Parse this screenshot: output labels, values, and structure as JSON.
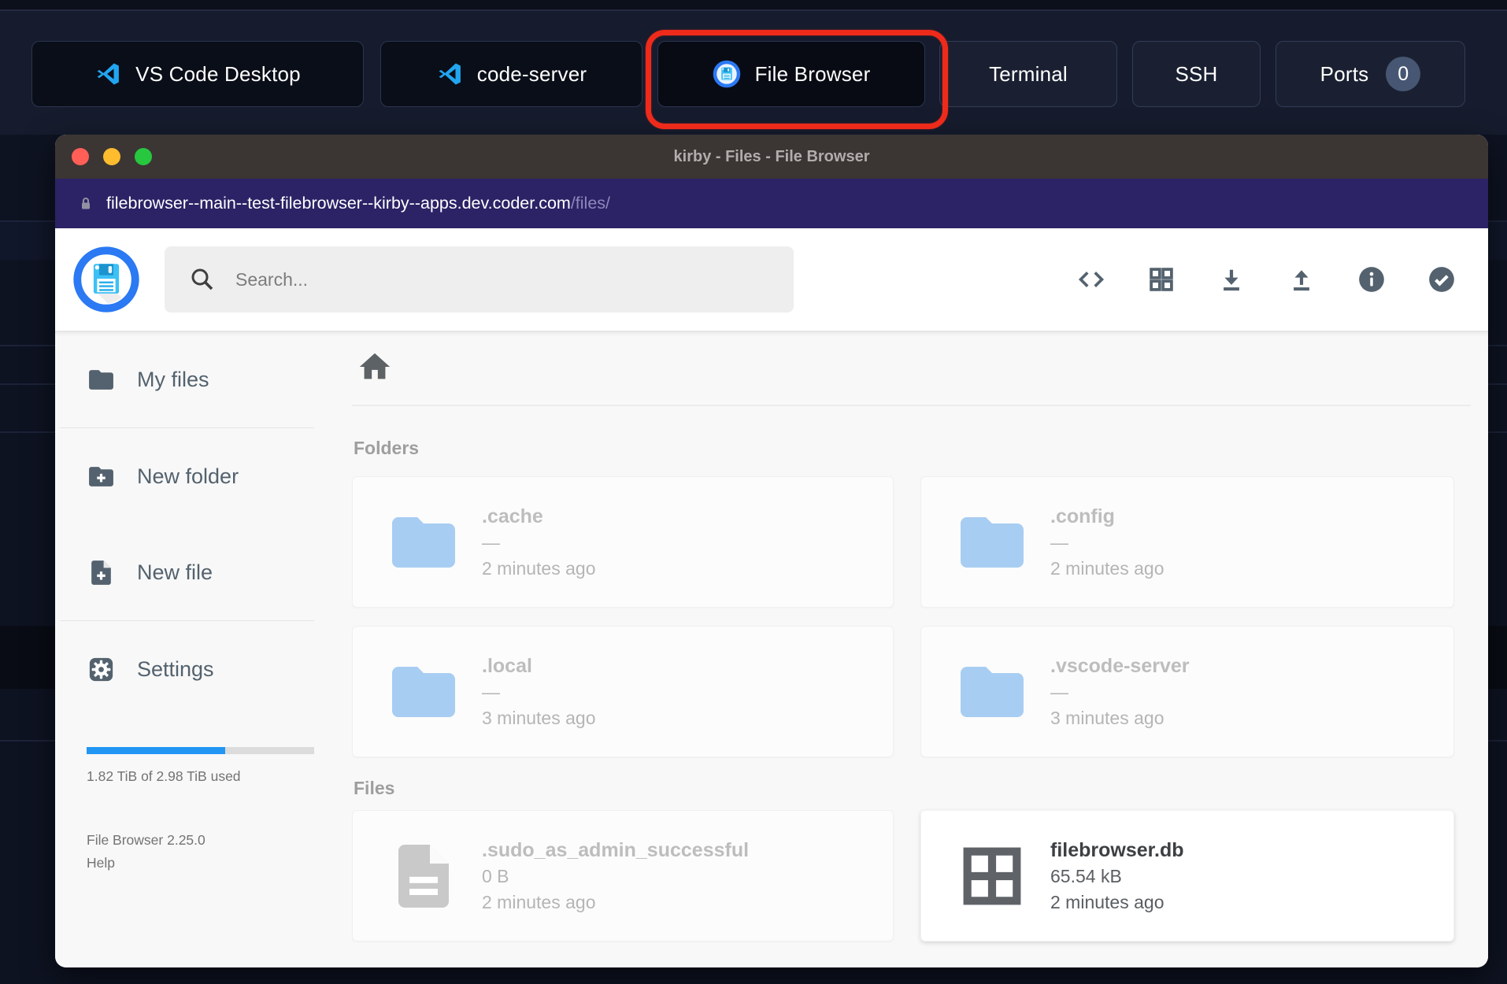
{
  "top_bar": {
    "tabs": [
      {
        "label": "VS Code Desktop"
      },
      {
        "label": "code-server"
      },
      {
        "label": "File Browser",
        "highlighted": true
      },
      {
        "label": "Terminal"
      },
      {
        "label": "SSH"
      },
      {
        "label": "Ports",
        "badge": "0"
      }
    ]
  },
  "window": {
    "title": "kirby - Files - File Browser",
    "url_domain": "filebrowser--main--test-filebrowser--kirby--apps.dev.coder.com",
    "url_path": "/files/"
  },
  "header": {
    "search_placeholder": "Search...",
    "icons": [
      "code-icon",
      "grid-view-icon",
      "download-icon",
      "upload-icon",
      "info-icon",
      "check-circle-icon"
    ]
  },
  "sidebar": {
    "items": [
      {
        "label": "My files",
        "icon": "folder-icon"
      },
      {
        "label": "New folder",
        "icon": "folder-plus-icon"
      },
      {
        "label": "New file",
        "icon": "file-plus-icon"
      },
      {
        "label": "Settings",
        "icon": "gear-icon"
      }
    ],
    "storage": {
      "label": "1.82 TiB of 2.98 TiB used",
      "used": "1.82 TiB",
      "total": "2.98 TiB",
      "percent_used": 61
    },
    "version": "File Browser 2.25.0",
    "help": "Help"
  },
  "main": {
    "folders": {
      "title": "Folders",
      "items": [
        {
          "name": ".cache",
          "size": "—",
          "time": "2 minutes ago"
        },
        {
          "name": ".config",
          "size": "—",
          "time": "2 minutes ago"
        },
        {
          "name": ".local",
          "size": "—",
          "time": "3 minutes ago"
        },
        {
          "name": ".vscode-server",
          "size": "—",
          "time": "3 minutes ago"
        }
      ]
    },
    "files": {
      "title": "Files",
      "items": [
        {
          "name": ".sudo_as_admin_successful",
          "size": "0 B",
          "time": "2 minutes ago"
        },
        {
          "name": "filebrowser.db",
          "size": "65.54 kB",
          "time": "2 minutes ago"
        }
      ]
    }
  },
  "colors": {
    "accent_blue": "#2196f3",
    "logo_blue": "#2b79f3",
    "highlight_red": "#ee2b1b",
    "urlbar_purple": "#2b2366",
    "titlebar_brown": "#3b3534",
    "topbar_navy": "#161c2d",
    "icon_slate": "#53626e",
    "hidden_item_gray": "#bdbdbd",
    "folder_blue": "#a8cdf2"
  }
}
